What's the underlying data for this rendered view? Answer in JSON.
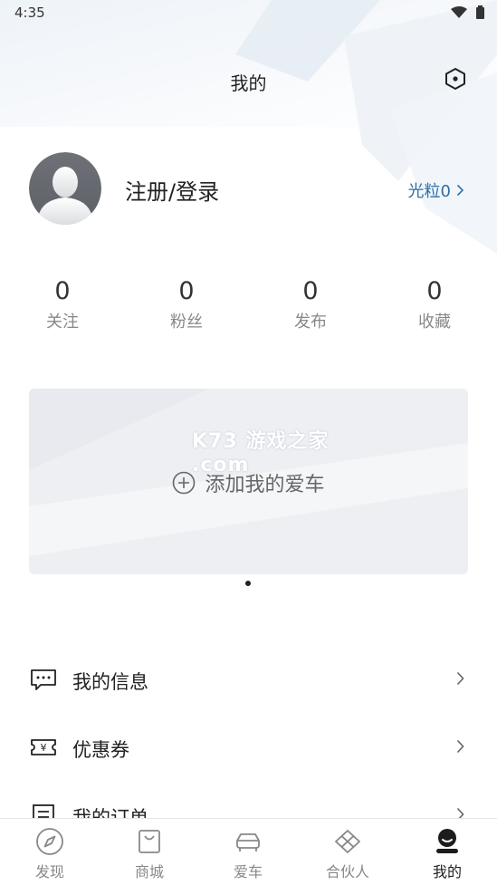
{
  "status_bar": {
    "time": "4:35"
  },
  "header": {
    "title": "我的"
  },
  "profile": {
    "login_text": "注册/登录",
    "points_label": "光粒0"
  },
  "stats": [
    {
      "value": "0",
      "label": "关注"
    },
    {
      "value": "0",
      "label": "粉丝"
    },
    {
      "value": "0",
      "label": "发布"
    },
    {
      "value": "0",
      "label": "收藏"
    }
  ],
  "car_card": {
    "add_label": "添加我的爱车",
    "watermark": "K73 游戏之家 .com"
  },
  "menu": [
    {
      "label": "我的信息",
      "icon": "message-icon"
    },
    {
      "label": "优惠券",
      "icon": "coupon-icon"
    },
    {
      "label": "我的订单",
      "icon": "order-icon"
    }
  ],
  "tabbar": {
    "active_index": 4,
    "tabs": [
      {
        "label": "发现",
        "icon": "compass-icon"
      },
      {
        "label": "商城",
        "icon": "shopping-bag-icon"
      },
      {
        "label": "爱车",
        "icon": "car-icon"
      },
      {
        "label": "合伙人",
        "icon": "partner-diamond-icon"
      },
      {
        "label": "我的",
        "icon": "user-icon"
      }
    ]
  },
  "colors": {
    "accent": "#2e6fa8",
    "text": "#222222",
    "muted": "#888888"
  }
}
